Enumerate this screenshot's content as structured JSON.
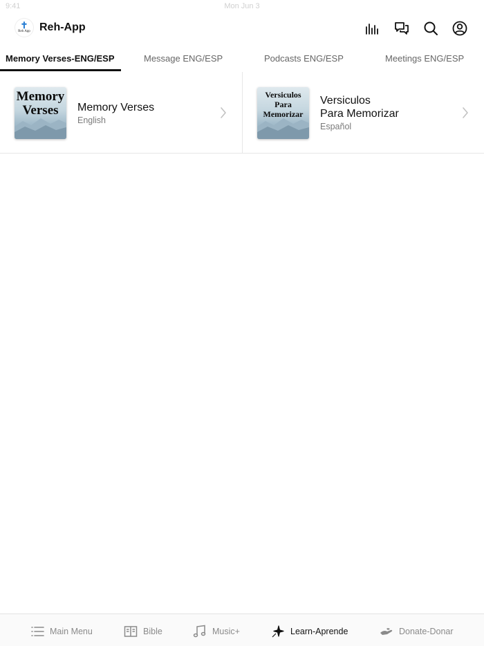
{
  "status_bar": {
    "time": "9:41",
    "date": "Mon Jun 3"
  },
  "header": {
    "title": "Reh-App",
    "logo_text": "Reh App",
    "icons": [
      "audio-bars-icon",
      "chat-bubbles-icon",
      "search-icon",
      "account-icon"
    ]
  },
  "tabs": [
    {
      "label": "Memory Verses-ENG/ESP",
      "active": true
    },
    {
      "label": "Message ENG/ESP",
      "active": false
    },
    {
      "label": "Podcasts ENG/ESP",
      "active": false
    },
    {
      "label": "Meetings ENG/ESP",
      "active": false
    }
  ],
  "cards": [
    {
      "thumb_text": "Memory\nVerses",
      "title": "Memory Verses",
      "subtitle": "English"
    },
    {
      "thumb_text": "Versiculos\nPara\nMemorizar",
      "title": "Versiculos\nPara Memorizar",
      "subtitle": "Español"
    }
  ],
  "bottom_nav": [
    {
      "label": "Main Menu",
      "icon": "list-icon",
      "active": false
    },
    {
      "label": "Bible",
      "icon": "book-icon",
      "active": false
    },
    {
      "label": "Music+",
      "icon": "music-note-icon",
      "active": false
    },
    {
      "label": "Learn-Aprende",
      "icon": "sparkle-icon",
      "active": true
    },
    {
      "label": "Donate-Donar",
      "icon": "giving-hand-icon",
      "active": false
    }
  ],
  "colors": {
    "accent": "#111111",
    "inactive": "#8a8a8a",
    "logo_cross": "#2a7fd4"
  }
}
